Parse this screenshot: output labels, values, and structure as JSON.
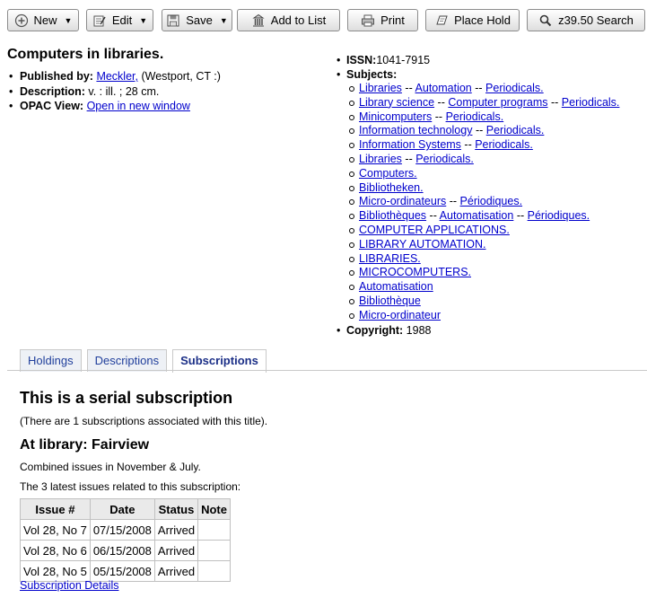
{
  "toolbar": {
    "new": "New",
    "edit": "Edit",
    "save": "Save",
    "add_to_list": "Add to List",
    "print": "Print",
    "place_hold": "Place Hold",
    "z3950": "z39.50 Search"
  },
  "record": {
    "title": "Computers in libraries.",
    "published_label": "Published by:",
    "publisher_link": "Meckler,",
    "publisher_place": " (Westport, CT :)",
    "description_label": "Description:",
    "description": " v. : ill. ; 28 cm.",
    "opac_label": "OPAC View:",
    "opac_link": "Open in new window",
    "issn_label": "ISSN:",
    "issn": "1041-7915",
    "subjects_label": "Subjects:",
    "subjects": [
      [
        "Libraries",
        "Automation",
        "Periodicals."
      ],
      [
        "Library science",
        "Computer programs",
        "Periodicals."
      ],
      [
        "Minicomputers",
        "Periodicals."
      ],
      [
        "Information technology",
        "Periodicals."
      ],
      [
        "Information Systems",
        "Periodicals."
      ],
      [
        "Libraries",
        "Periodicals."
      ],
      [
        "Computers."
      ],
      [
        "Bibliotheken."
      ],
      [
        "Micro-ordinateurs",
        "Périodiques."
      ],
      [
        "Bibliothèques",
        "Automatisation",
        "Périodiques."
      ],
      [
        "COMPUTER APPLICATIONS."
      ],
      [
        "LIBRARY AUTOMATION."
      ],
      [
        "LIBRARIES."
      ],
      [
        "MICROCOMPUTERS."
      ],
      [
        "Automatisation"
      ],
      [
        "Bibliothèque"
      ],
      [
        "Micro-ordinateur"
      ]
    ],
    "subject_separator": " -- ",
    "copyright_label": "Copyright:",
    "copyright": " 1988"
  },
  "tabs": [
    "Holdings",
    "Descriptions",
    "Subscriptions"
  ],
  "subscription": {
    "heading": "This is a serial subscription",
    "count_note": "(There are 1 subscriptions associated with this title).",
    "library_heading": "At library: Fairview",
    "combined_note": "Combined issues in November & July.",
    "latest_note": "The 3 latest issues related to this subscription:",
    "columns": [
      "Issue #",
      "Date",
      "Status",
      "Note"
    ],
    "rows": [
      [
        "Vol 28, No 7",
        "07/15/2008",
        "Arrived",
        ""
      ],
      [
        "Vol 28, No 6",
        "06/15/2008",
        "Arrived",
        ""
      ],
      [
        "Vol 28, No 5",
        "05/15/2008",
        "Arrived",
        ""
      ]
    ],
    "details_link": "Subscription Details"
  }
}
